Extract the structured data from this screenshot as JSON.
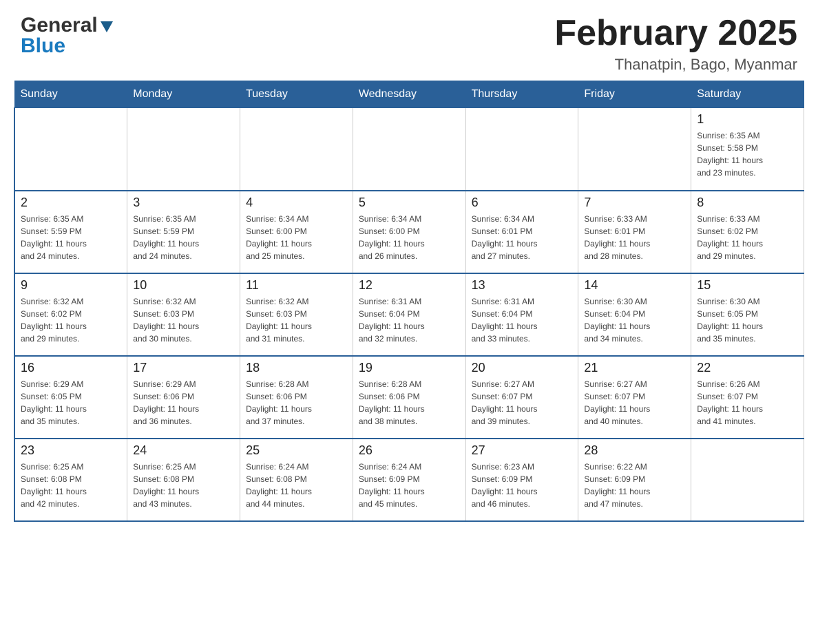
{
  "header": {
    "logo_line1": "General",
    "logo_line2": "Blue",
    "month_title": "February 2025",
    "location": "Thanatpin, Bago, Myanmar"
  },
  "days_of_week": [
    "Sunday",
    "Monday",
    "Tuesday",
    "Wednesday",
    "Thursday",
    "Friday",
    "Saturday"
  ],
  "weeks": [
    [
      {
        "day": "",
        "info": ""
      },
      {
        "day": "",
        "info": ""
      },
      {
        "day": "",
        "info": ""
      },
      {
        "day": "",
        "info": ""
      },
      {
        "day": "",
        "info": ""
      },
      {
        "day": "",
        "info": ""
      },
      {
        "day": "1",
        "info": "Sunrise: 6:35 AM\nSunset: 5:58 PM\nDaylight: 11 hours\nand 23 minutes."
      }
    ],
    [
      {
        "day": "2",
        "info": "Sunrise: 6:35 AM\nSunset: 5:59 PM\nDaylight: 11 hours\nand 24 minutes."
      },
      {
        "day": "3",
        "info": "Sunrise: 6:35 AM\nSunset: 5:59 PM\nDaylight: 11 hours\nand 24 minutes."
      },
      {
        "day": "4",
        "info": "Sunrise: 6:34 AM\nSunset: 6:00 PM\nDaylight: 11 hours\nand 25 minutes."
      },
      {
        "day": "5",
        "info": "Sunrise: 6:34 AM\nSunset: 6:00 PM\nDaylight: 11 hours\nand 26 minutes."
      },
      {
        "day": "6",
        "info": "Sunrise: 6:34 AM\nSunset: 6:01 PM\nDaylight: 11 hours\nand 27 minutes."
      },
      {
        "day": "7",
        "info": "Sunrise: 6:33 AM\nSunset: 6:01 PM\nDaylight: 11 hours\nand 28 minutes."
      },
      {
        "day": "8",
        "info": "Sunrise: 6:33 AM\nSunset: 6:02 PM\nDaylight: 11 hours\nand 29 minutes."
      }
    ],
    [
      {
        "day": "9",
        "info": "Sunrise: 6:32 AM\nSunset: 6:02 PM\nDaylight: 11 hours\nand 29 minutes."
      },
      {
        "day": "10",
        "info": "Sunrise: 6:32 AM\nSunset: 6:03 PM\nDaylight: 11 hours\nand 30 minutes."
      },
      {
        "day": "11",
        "info": "Sunrise: 6:32 AM\nSunset: 6:03 PM\nDaylight: 11 hours\nand 31 minutes."
      },
      {
        "day": "12",
        "info": "Sunrise: 6:31 AM\nSunset: 6:04 PM\nDaylight: 11 hours\nand 32 minutes."
      },
      {
        "day": "13",
        "info": "Sunrise: 6:31 AM\nSunset: 6:04 PM\nDaylight: 11 hours\nand 33 minutes."
      },
      {
        "day": "14",
        "info": "Sunrise: 6:30 AM\nSunset: 6:04 PM\nDaylight: 11 hours\nand 34 minutes."
      },
      {
        "day": "15",
        "info": "Sunrise: 6:30 AM\nSunset: 6:05 PM\nDaylight: 11 hours\nand 35 minutes."
      }
    ],
    [
      {
        "day": "16",
        "info": "Sunrise: 6:29 AM\nSunset: 6:05 PM\nDaylight: 11 hours\nand 35 minutes."
      },
      {
        "day": "17",
        "info": "Sunrise: 6:29 AM\nSunset: 6:06 PM\nDaylight: 11 hours\nand 36 minutes."
      },
      {
        "day": "18",
        "info": "Sunrise: 6:28 AM\nSunset: 6:06 PM\nDaylight: 11 hours\nand 37 minutes."
      },
      {
        "day": "19",
        "info": "Sunrise: 6:28 AM\nSunset: 6:06 PM\nDaylight: 11 hours\nand 38 minutes."
      },
      {
        "day": "20",
        "info": "Sunrise: 6:27 AM\nSunset: 6:07 PM\nDaylight: 11 hours\nand 39 minutes."
      },
      {
        "day": "21",
        "info": "Sunrise: 6:27 AM\nSunset: 6:07 PM\nDaylight: 11 hours\nand 40 minutes."
      },
      {
        "day": "22",
        "info": "Sunrise: 6:26 AM\nSunset: 6:07 PM\nDaylight: 11 hours\nand 41 minutes."
      }
    ],
    [
      {
        "day": "23",
        "info": "Sunrise: 6:25 AM\nSunset: 6:08 PM\nDaylight: 11 hours\nand 42 minutes."
      },
      {
        "day": "24",
        "info": "Sunrise: 6:25 AM\nSunset: 6:08 PM\nDaylight: 11 hours\nand 43 minutes."
      },
      {
        "day": "25",
        "info": "Sunrise: 6:24 AM\nSunset: 6:08 PM\nDaylight: 11 hours\nand 44 minutes."
      },
      {
        "day": "26",
        "info": "Sunrise: 6:24 AM\nSunset: 6:09 PM\nDaylight: 11 hours\nand 45 minutes."
      },
      {
        "day": "27",
        "info": "Sunrise: 6:23 AM\nSunset: 6:09 PM\nDaylight: 11 hours\nand 46 minutes."
      },
      {
        "day": "28",
        "info": "Sunrise: 6:22 AM\nSunset: 6:09 PM\nDaylight: 11 hours\nand 47 minutes."
      },
      {
        "day": "",
        "info": ""
      }
    ]
  ]
}
